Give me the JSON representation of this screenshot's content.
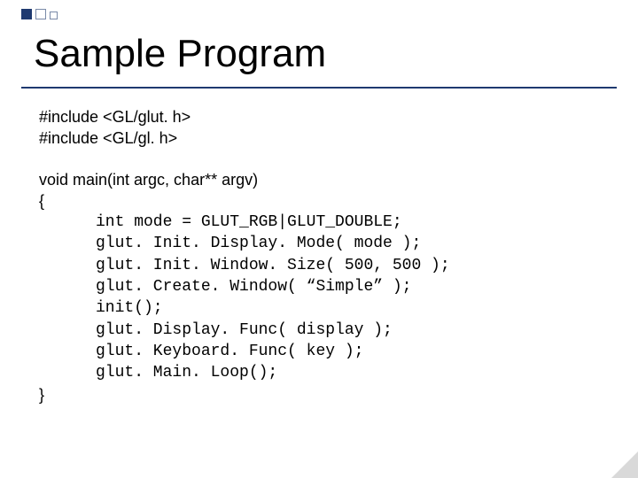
{
  "title": "Sample Program",
  "includes": {
    "line1": "#include <GL/glut. h>",
    "line2": "#include <GL/gl. h>"
  },
  "main": {
    "signature": "void main(int argc, char** argv)",
    "open_brace": "{",
    "close_brace": "}",
    "body": {
      "l1": "int mode = GLUT_RGB|GLUT_DOUBLE; ",
      "l2": "glut. Init. Display. Mode( mode );",
      "l3": "glut. Init. Window. Size( 500, 500 );",
      "l4": "glut. Create. Window( “Simple” );",
      "l5": "init();",
      "l6": "glut. Display. Func( display ); ",
      "l7": "glut. Keyboard. Func( key );",
      "l8": "glut. Main. Loop();"
    }
  }
}
